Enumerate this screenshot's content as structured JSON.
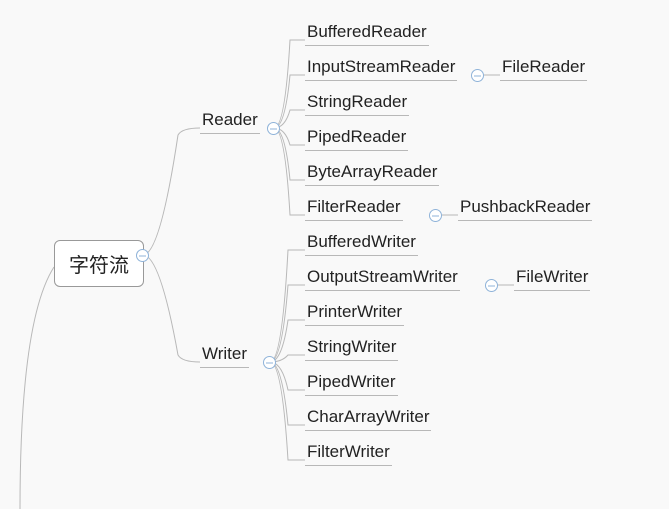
{
  "root": {
    "label": "字符流"
  },
  "branches": {
    "reader": {
      "label": "Reader",
      "children": [
        {
          "label": "BufferedReader"
        },
        {
          "label": "InputStreamReader",
          "child": {
            "label": "FileReader"
          }
        },
        {
          "label": "StringReader"
        },
        {
          "label": "PipedReader"
        },
        {
          "label": "ByteArrayReader"
        },
        {
          "label": "FilterReader",
          "child": {
            "label": "PushbackReader"
          }
        }
      ]
    },
    "writer": {
      "label": "Writer",
      "children": [
        {
          "label": "BufferedWriter"
        },
        {
          "label": "OutputStreamWriter",
          "child": {
            "label": "FileWriter"
          }
        },
        {
          "label": "PrinterWriter"
        },
        {
          "label": "StringWriter"
        },
        {
          "label": "PipedWriter"
        },
        {
          "label": "CharArrayWriter"
        },
        {
          "label": "FilterWriter"
        }
      ]
    }
  }
}
